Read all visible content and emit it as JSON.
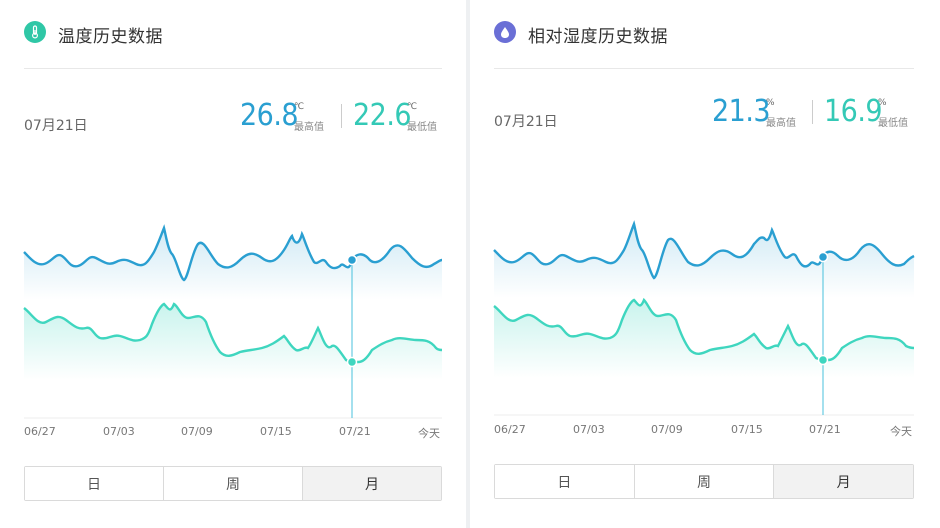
{
  "panels": [
    {
      "title": "温度历史数据",
      "icon": "thermometer-icon",
      "icon_color": "#2fc7a6",
      "date": "07月21日",
      "max": {
        "value": "26.8",
        "unit": "℃",
        "label": "最高值"
      },
      "min": {
        "value": "22.6",
        "unit": "℃",
        "label": "最低值"
      },
      "xticks": [
        "06/27",
        "07/03",
        "07/09",
        "07/15",
        "07/21",
        "今天"
      ],
      "segments": [
        "日",
        "周",
        "月"
      ],
      "active_segment": "月"
    },
    {
      "title": "相对湿度历史数据",
      "icon": "water-drop-icon",
      "icon_color": "#6a6fd6",
      "date": "07月21日",
      "max": {
        "value": "21.3",
        "unit": "%",
        "label": "最高值"
      },
      "min": {
        "value": "16.9",
        "unit": "%",
        "label": "最低值"
      },
      "xticks": [
        "06/27",
        "07/03",
        "07/09",
        "07/15",
        "07/21",
        "今天"
      ],
      "segments": [
        "日",
        "周",
        "月"
      ],
      "active_segment": "月"
    }
  ],
  "colors": {
    "max_line": "#2a9fd1",
    "min_line": "#3fd6bf",
    "max_value": "#2a9fd1",
    "min_value": "#34c9b6"
  }
}
